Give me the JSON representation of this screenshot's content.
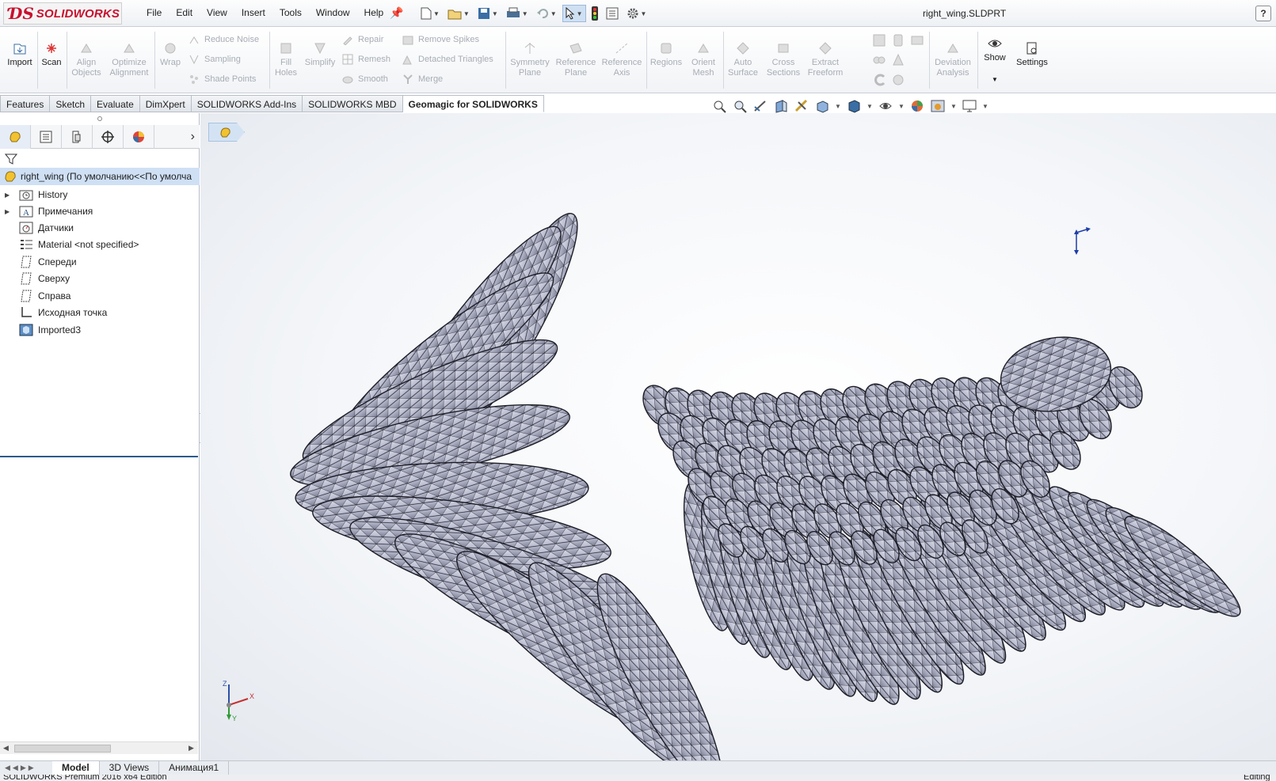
{
  "app": {
    "brand": "SOLIDWORKS",
    "document_title": "right_wing.SLDPRT"
  },
  "menu": [
    "File",
    "Edit",
    "View",
    "Insert",
    "Tools",
    "Window",
    "Help"
  ],
  "ribbon": {
    "import": "Import",
    "scan": "Scan",
    "align_objects": [
      "Align",
      "Objects"
    ],
    "optimize_alignment": [
      "Optimize",
      "Alignment"
    ],
    "wrap": "Wrap",
    "reduce_noise": "Reduce Noise",
    "sampling": "Sampling",
    "shade_points": "Shade Points",
    "fill_holes": [
      "Fill",
      "Holes"
    ],
    "simplify": "Simplify",
    "repair": "Repair",
    "remesh": "Remesh",
    "smooth": "Smooth",
    "remove_spikes": "Remove Spikes",
    "detached_triangles": "Detached Triangles",
    "merge": "Merge",
    "symmetry_plane": [
      "Symmetry",
      "Plane"
    ],
    "reference_plane": [
      "Reference",
      "Plane"
    ],
    "reference_axis": [
      "Reference",
      "Axis"
    ],
    "regions": "Regions",
    "orient_mesh": [
      "Orient",
      "Mesh"
    ],
    "auto_surface": [
      "Auto",
      "Surface"
    ],
    "cross_sections": [
      "Cross",
      "Sections"
    ],
    "extract_freeform": [
      "Extract",
      "Freeform"
    ],
    "deviation_analysis": [
      "Deviation",
      "Analysis"
    ],
    "show": "Show",
    "settings": "Settings"
  },
  "tabs": [
    "Features",
    "Sketch",
    "Evaluate",
    "DimXpert",
    "SOLIDWORKS Add-Ins",
    "SOLIDWORKS MBD",
    "Geomagic for SOLIDWORKS"
  ],
  "active_tab": "Geomagic for SOLIDWORKS",
  "tree": {
    "root": "right_wing  (По умолчанию<<По умолча",
    "items": [
      {
        "label": "History",
        "expandable": true,
        "icon": "history-folder-icon"
      },
      {
        "label": "Примечания",
        "expandable": true,
        "icon": "annotations-icon"
      },
      {
        "label": "Датчики",
        "expandable": false,
        "icon": "sensors-icon"
      },
      {
        "label": "Material <not specified>",
        "expandable": false,
        "icon": "material-icon"
      },
      {
        "label": "Спереди",
        "expandable": false,
        "icon": "plane-icon"
      },
      {
        "label": "Сверху",
        "expandable": false,
        "icon": "plane-icon"
      },
      {
        "label": "Справа",
        "expandable": false,
        "icon": "plane-icon"
      },
      {
        "label": "Исходная точка",
        "expandable": false,
        "icon": "origin-icon"
      },
      {
        "label": "Imported3",
        "expandable": false,
        "icon": "imported-body-icon"
      }
    ]
  },
  "bottom_tabs": [
    "Model",
    "3D Views",
    "Анимация1"
  ],
  "active_bottom_tab": "Model",
  "status": {
    "left": "SOLIDWORKS Premium 2016 x64 Edition",
    "right": "Editing"
  },
  "triad_labels": {
    "z": "Z",
    "x": "X",
    "y": "Y"
  },
  "colors": {
    "brand": "#c8102e",
    "mesh_fill": "#b7bacd",
    "mesh_edge": "#1c1c26",
    "tree_selection": "#cfe0f5"
  }
}
